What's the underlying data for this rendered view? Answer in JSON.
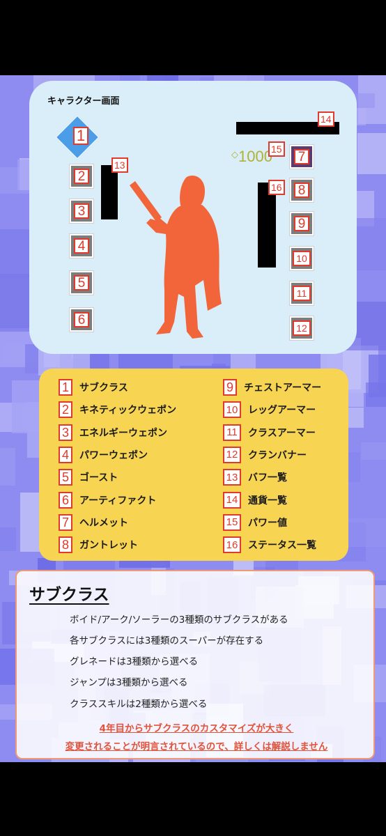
{
  "screen": {
    "title": "キャラクター画面",
    "power_value": "1000",
    "power_icon": "power-diamond-icon",
    "slot_numbers_left": [
      "1",
      "2",
      "3",
      "4",
      "5",
      "6"
    ],
    "slot_numbers_right": [
      "7",
      "8",
      "9",
      "10",
      "11",
      "12"
    ],
    "tag_13": "13",
    "tag_14": "14",
    "tag_15": "15",
    "tag_16": "16"
  },
  "legend": {
    "left": [
      {
        "num": "1",
        "label": "サブクラス"
      },
      {
        "num": "2",
        "label": "キネティックウェポン"
      },
      {
        "num": "3",
        "label": "エネルギーウェポン"
      },
      {
        "num": "4",
        "label": "パワーウェポン"
      },
      {
        "num": "5",
        "label": "ゴースト"
      },
      {
        "num": "6",
        "label": "アーティファクト"
      },
      {
        "num": "7",
        "label": "ヘルメット"
      },
      {
        "num": "8",
        "label": "ガントレット"
      }
    ],
    "right": [
      {
        "num": "9",
        "label": "チェストアーマー"
      },
      {
        "num": "10",
        "label": "レッグアーマー"
      },
      {
        "num": "11",
        "label": "クラスアーマー"
      },
      {
        "num": "12",
        "label": "クランバナー"
      },
      {
        "num": "13",
        "label": "バフ一覧"
      },
      {
        "num": "14",
        "label": "通貨一覧"
      },
      {
        "num": "15",
        "label": "パワー値"
      },
      {
        "num": "16",
        "label": "ステータス一覧"
      }
    ]
  },
  "info": {
    "title": "サブクラス",
    "lines": [
      "ボイド/アーク/ソーラーの3種類のサブクラスがある",
      "各サブクラスには3種類のスーパーが存在する",
      "グレネードは3種類から選べる",
      "ジャンプは3種類から選べる",
      "クラススキルは2種類から選べる"
    ],
    "note_line1": "4年目からサブクラスのカスタマイズが大きく",
    "note_line2": "変更されることが明言されているので、詳しくは解説しません"
  },
  "colors": {
    "accent_red": "#e03a2c",
    "legend_bg": "#f7d553",
    "card_bg": "#d9eef8",
    "subclass_blue": "#4a9de6",
    "silhouette": "#f2643a",
    "power_gold": "#b3b03a"
  }
}
